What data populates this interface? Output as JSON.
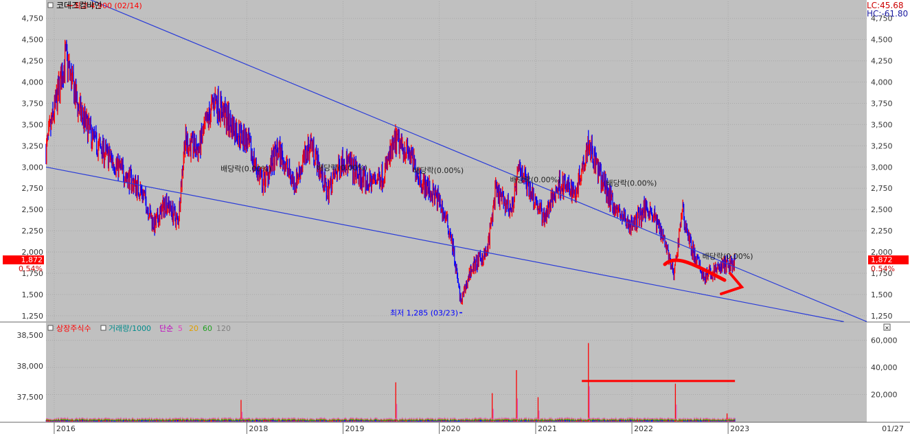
{
  "title": "코데즈컴바인",
  "corner": {
    "lc": "LC:45.68",
    "hc": "HC:-61.80",
    "date": "01/27"
  },
  "price_box": {
    "price": "1,872",
    "change": "0.54%"
  },
  "indicator_legend": {
    "shares": "상장주식수",
    "volume": "거래량/1000",
    "ma_prefix": "단순",
    "ma_periods": [
      "5",
      "20",
      "60",
      "120"
    ]
  },
  "colors": {
    "panel": "#c0c0c0",
    "up": "#ff0000",
    "down": "#0000ff",
    "trendline": "#2a3cd8",
    "ma5": "#e040c0",
    "ma20": "#e0a000",
    "ma60": "#20a020",
    "ma120": "#808080",
    "vol_line": "#00a0a0",
    "price_box": "#ff0000",
    "shares_line": "#ff0000"
  },
  "chart_data": [
    {
      "type": "candlestick",
      "name": "price",
      "y_range": [
        1200,
        4950
      ],
      "y_ticks": [
        "1,250",
        "1,500",
        "1,750",
        "2,000",
        "2,250",
        "2,500",
        "2,750",
        "3,000",
        "3,250",
        "3,500",
        "3,750",
        "4,000",
        "4,250",
        "4,500",
        "4,750"
      ],
      "y_tick_values": [
        1250,
        1500,
        1750,
        2000,
        2250,
        2500,
        2750,
        3000,
        3250,
        3500,
        3750,
        4000,
        4250,
        4500,
        4750
      ],
      "x_range": [
        "2015-12-01",
        "2024-06-10"
      ],
      "x_ticks": [
        "2016",
        "2018",
        "2019",
        "2020",
        "2021",
        "2022",
        "2023"
      ],
      "x_tick_dates": [
        "2016-01-01",
        "2018-01-01",
        "2019-01-01",
        "2020-01-01",
        "2021-01-01",
        "2022-01-01",
        "2023-01-01"
      ],
      "close_path": [
        [
          "2015-12-01",
          3200
        ],
        [
          "2016-02-14",
          4300
        ],
        [
          "2016-04-01",
          3700
        ],
        [
          "2016-06-01",
          3300
        ],
        [
          "2016-09-01",
          3000
        ],
        [
          "2016-12-01",
          2700
        ],
        [
          "2017-01-15",
          2300
        ],
        [
          "2017-03-01",
          2600
        ],
        [
          "2017-04-15",
          2350
        ],
        [
          "2017-05-10",
          3300
        ],
        [
          "2017-07-01",
          3200
        ],
        [
          "2017-09-01",
          3800
        ],
        [
          "2017-11-01",
          3500
        ],
        [
          "2018-01-01",
          3300
        ],
        [
          "2018-03-01",
          2800
        ],
        [
          "2018-05-01",
          3200
        ],
        [
          "2018-07-01",
          2800
        ],
        [
          "2018-09-01",
          3300
        ],
        [
          "2018-11-01",
          2700
        ],
        [
          "2019-01-01",
          3100
        ],
        [
          "2019-04-01",
          2800
        ],
        [
          "2019-06-01",
          2900
        ],
        [
          "2019-07-20",
          3300
        ],
        [
          "2019-09-01",
          3200
        ],
        [
          "2019-11-01",
          2800
        ],
        [
          "2020-01-01",
          2600
        ],
        [
          "2020-02-15",
          2200
        ],
        [
          "2020-03-23",
          1400
        ],
        [
          "2020-05-01",
          1800
        ],
        [
          "2020-07-01",
          2000
        ],
        [
          "2020-08-01",
          2700
        ],
        [
          "2020-10-01",
          2500
        ],
        [
          "2020-11-01",
          3000
        ],
        [
          "2021-01-01",
          2600
        ],
        [
          "2021-02-01",
          2400
        ],
        [
          "2021-04-01",
          2800
        ],
        [
          "2021-06-01",
          2700
        ],
        [
          "2021-07-20",
          3300
        ],
        [
          "2021-09-01",
          2900
        ],
        [
          "2021-11-01",
          2500
        ],
        [
          "2022-01-01",
          2300
        ],
        [
          "2022-03-01",
          2550
        ],
        [
          "2022-05-01",
          2200
        ],
        [
          "2022-06-10",
          1700
        ],
        [
          "2022-07-10",
          2500
        ],
        [
          "2022-08-15",
          2050
        ],
        [
          "2022-10-01",
          1700
        ],
        [
          "2022-12-15",
          1850
        ],
        [
          "2023-01-27",
          1872
        ]
      ],
      "current": 1872,
      "annotations": [
        {
          "text": "최고 4,900 (02/14)",
          "date": "2016-02-14",
          "value": 4900,
          "color": "#ff0000"
        },
        {
          "text": "최저 1,285 (03/23)",
          "date": "2020-03-23",
          "value": 1285,
          "color": "#0000ff"
        },
        {
          "text": "배당락(0.00%)",
          "date": "2017-12-26",
          "value": 2950
        },
        {
          "text": "배당락(0.00%)",
          "date": "2018-12-26",
          "value": 2960
        },
        {
          "text": "배당락(0.00%)",
          "date": "2019-12-26",
          "value": 2930
        },
        {
          "text": "배당락(0.00%)",
          "date": "2020-12-28",
          "value": 2820
        },
        {
          "text": "배당락(0.00%)",
          "date": "2021-12-28",
          "value": 2780
        },
        {
          "text": "배당락(0.00%)",
          "date": "2022-12-28",
          "value": 1920
        }
      ],
      "trendlines": [
        {
          "from": [
            "2016-05-01",
            4990
          ],
          "to": [
            "2024-06-10",
            1180
          ]
        },
        {
          "from": [
            "2015-12-01",
            3000
          ],
          "to": [
            "2024-03-15",
            1180
          ]
        }
      ]
    },
    {
      "type": "volume",
      "name": "volume_panel",
      "y_range": [
        0,
        72000
      ],
      "y_ticks_right": [
        "20,000",
        "40,000",
        "60,000"
      ],
      "y_ticks_right_values": [
        20000,
        40000,
        60000
      ],
      "y_ticks_left": [
        "37,500",
        "38,000",
        "38,500"
      ],
      "spikes": [
        [
          "2017-12-10",
          16000
        ],
        [
          "2019-07-20",
          29000
        ],
        [
          "2020-07-20",
          21000
        ],
        [
          "2020-10-20",
          38000
        ],
        [
          "2021-01-10",
          18000
        ],
        [
          "2021-07-20",
          58000
        ],
        [
          "2022-06-15",
          28000
        ],
        [
          "2022-12-28",
          6000
        ]
      ],
      "hline": {
        "from": "2021-06-25",
        "to": "2023-01-27",
        "value": 30000
      }
    }
  ]
}
